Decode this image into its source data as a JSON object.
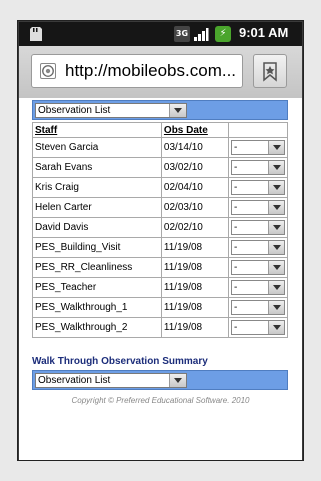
{
  "status": {
    "network": "3G",
    "time": "9:01 AM"
  },
  "browser": {
    "url": "http://mobileobs.com..."
  },
  "top_select": {
    "value": "Observation List"
  },
  "table": {
    "headers": {
      "staff": "Staff",
      "date": "Obs Date"
    },
    "rows": [
      {
        "staff": "Steven Garcia",
        "date": "03/14/10",
        "action": "-"
      },
      {
        "staff": "Sarah Evans",
        "date": "03/02/10",
        "action": "-"
      },
      {
        "staff": "Kris Craig",
        "date": "02/04/10",
        "action": "-"
      },
      {
        "staff": "Helen Carter",
        "date": "02/03/10",
        "action": "-"
      },
      {
        "staff": "David Davis",
        "date": "02/02/10",
        "action": "-"
      },
      {
        "staff": "PES_Building_Visit",
        "date": "11/19/08",
        "action": "-"
      },
      {
        "staff": "PES_RR_Cleanliness",
        "date": "11/19/08",
        "action": "-"
      },
      {
        "staff": "PES_Teacher",
        "date": "11/19/08",
        "action": "-"
      },
      {
        "staff": "PES_Walkthrough_1",
        "date": "11/19/08",
        "action": "-"
      },
      {
        "staff": "PES_Walkthrough_2",
        "date": "11/19/08",
        "action": "-"
      }
    ]
  },
  "summary_title": "Walk Through Observation Summary",
  "bottom_select": {
    "value": "Observation List"
  },
  "copyright": "Copyright © Preferred Educational Software. 2010"
}
